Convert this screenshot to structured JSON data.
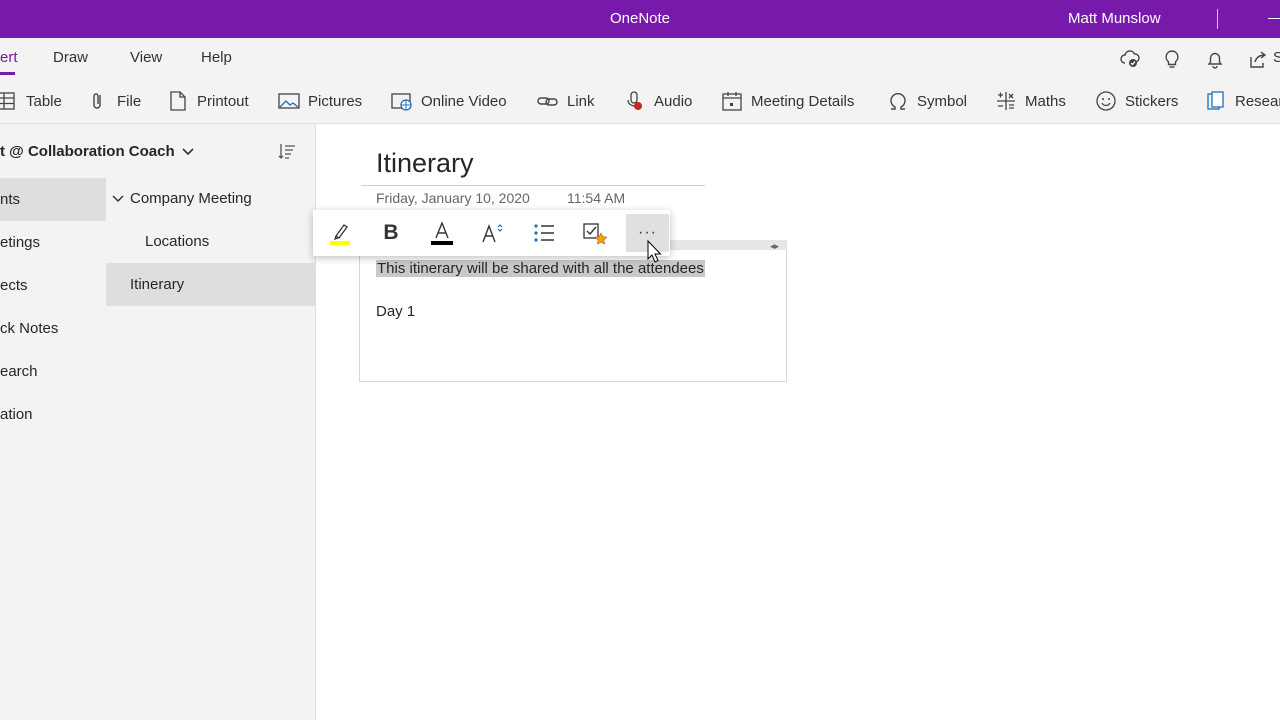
{
  "titlebar": {
    "app_title": "OneNote",
    "user_name": "Matt Munslow"
  },
  "menu": {
    "tabs": [
      {
        "label": "ert",
        "active": true
      },
      {
        "label": "Draw"
      },
      {
        "label": "View"
      },
      {
        "label": "Help"
      }
    ],
    "share_label": "S"
  },
  "ribbon": {
    "items": [
      {
        "label": "Table",
        "icon": "table-icon"
      },
      {
        "label": "File",
        "icon": "paperclip-icon"
      },
      {
        "label": "Printout",
        "icon": "document-icon"
      },
      {
        "label": "Pictures",
        "icon": "picture-icon"
      },
      {
        "label": "Online Video",
        "icon": "online-video-icon"
      },
      {
        "label": "Link",
        "icon": "link-icon"
      },
      {
        "label": "Audio",
        "icon": "microphone-icon"
      },
      {
        "label": "Meeting Details",
        "icon": "calendar-icon"
      },
      {
        "label": "Symbol",
        "icon": "omega-icon"
      },
      {
        "label": "Maths",
        "icon": "math-icon"
      },
      {
        "label": "Stickers",
        "icon": "smiley-icon"
      },
      {
        "label": "Resear",
        "icon": "research-icon"
      }
    ]
  },
  "notebook": {
    "name": "t @ Collaboration Coach"
  },
  "sections": [
    {
      "label": "nts",
      "selected": true
    },
    {
      "label": "etings"
    },
    {
      "label": "ects"
    },
    {
      "label": "ck Notes"
    },
    {
      "label": "earch"
    },
    {
      "label": "ation"
    }
  ],
  "pages": [
    {
      "label": "Company Meeting"
    },
    {
      "label": "Locations"
    },
    {
      "label": "Itinerary",
      "selected": true
    }
  ],
  "page": {
    "title": "Itinerary",
    "date": "Friday, January 10, 2020",
    "time": "11:54 AM",
    "lines": [
      "This itinerary will be shared with all the attendees",
      "Day 1"
    ]
  },
  "floating_toolbar": {
    "bold_label": "B",
    "more_label": "···",
    "highlight_color": "#ffff00",
    "font_color": "#000000"
  },
  "colors": {
    "accent": "#7719aa"
  }
}
